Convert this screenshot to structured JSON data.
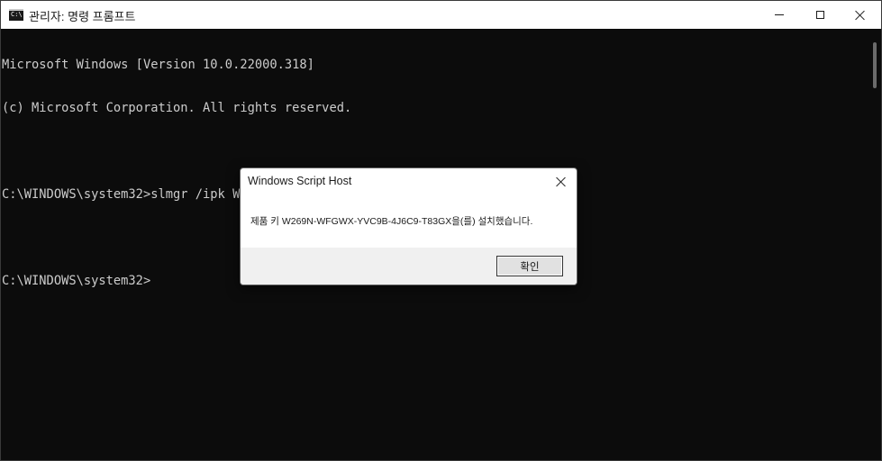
{
  "window": {
    "title": "관리자: 명령 프롬프트",
    "icon": "cmd-icon",
    "icon_text": "C:\\",
    "controls": {
      "minimize": "minimize-icon",
      "maximize": "maximize-icon",
      "close": "close-icon"
    }
  },
  "console": {
    "lines": [
      "Microsoft Windows [Version 10.0.22000.318]",
      "(c) Microsoft Corporation. All rights reserved.",
      "",
      "C:\\WINDOWS\\system32>slmgr /ipk W269N-WFGWX-YVC9B-4J6C9-T83GX",
      "",
      "C:\\WINDOWS\\system32>"
    ],
    "colors": {
      "background": "#0c0c0c",
      "text": "#cccccc"
    }
  },
  "dialog": {
    "title": "Windows Script Host",
    "message": "제품 키 W269N-WFGWX-YVC9B-4J6C9-T83GX을(를) 설치했습니다.",
    "ok_label": "확인",
    "close_icon": "close-icon"
  }
}
